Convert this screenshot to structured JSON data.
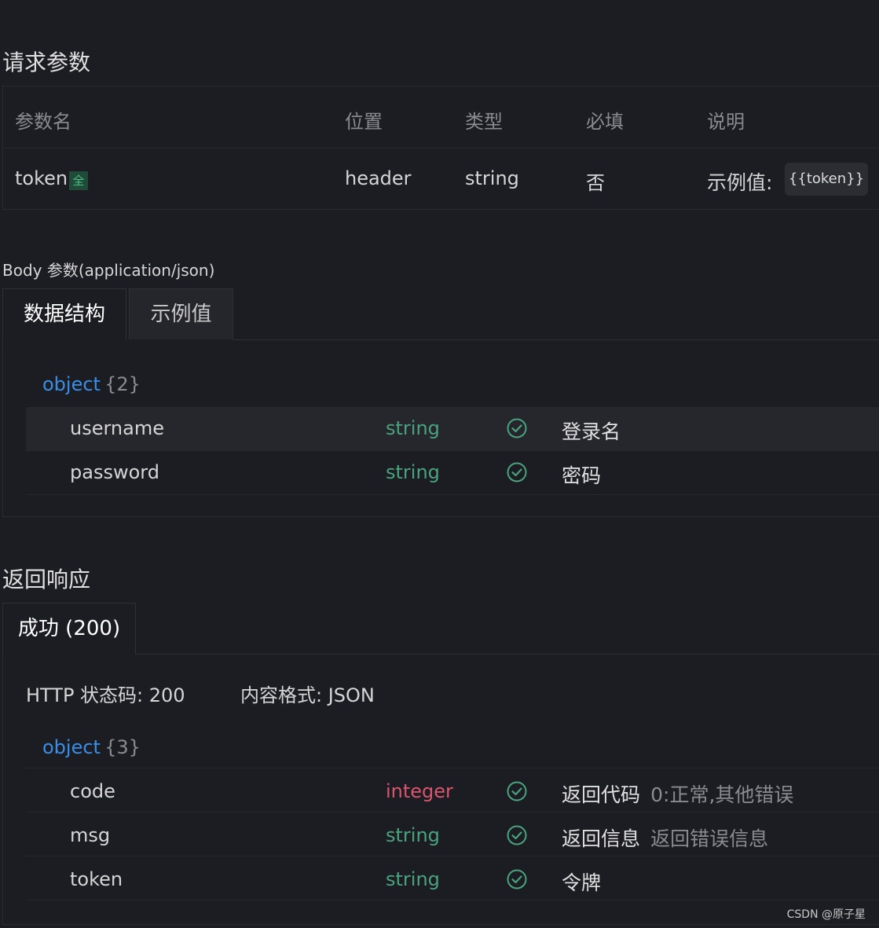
{
  "request": {
    "title": "请求参数",
    "headers": [
      "参数名",
      "位置",
      "类型",
      "必填",
      "说明"
    ],
    "row": {
      "name": "token",
      "badge": "全",
      "location": "header",
      "type": "string",
      "required": "否",
      "example_label": "示例值:",
      "example_value": "{{token}}"
    }
  },
  "body": {
    "label": "Body 参数(application/json)",
    "tabs": [
      "数据结构",
      "示例值"
    ],
    "active_tab": "数据结构",
    "object_type": "object",
    "object_count": "{2}",
    "fields": [
      {
        "name": "username",
        "type": "string",
        "required": true,
        "desc": "登录名"
      },
      {
        "name": "password",
        "type": "string",
        "required": true,
        "desc": "密码"
      }
    ]
  },
  "response": {
    "title": "返回响应",
    "tab": "成功 (200)",
    "status_text": "HTTP 状态码: 200",
    "format_text": "内容格式: JSON",
    "object_type": "object",
    "object_count": "{3}",
    "fields": [
      {
        "name": "code",
        "type": "integer",
        "required": true,
        "desc": "返回代码",
        "note": "0:正常,其他错误"
      },
      {
        "name": "msg",
        "type": "string",
        "required": true,
        "desc": "返回信息",
        "note": "返回错误信息"
      },
      {
        "name": "token",
        "type": "string",
        "required": true,
        "desc": "令牌",
        "note": ""
      }
    ]
  },
  "colors": {
    "background": "#1c1d22",
    "type_string": "#4aa37c",
    "type_integer": "#d9566f",
    "object_type": "#3a8ee6",
    "check": "#4aa37c"
  },
  "icons": {
    "required": "check-circle-icon"
  },
  "watermark": "CSDN @原子星"
}
